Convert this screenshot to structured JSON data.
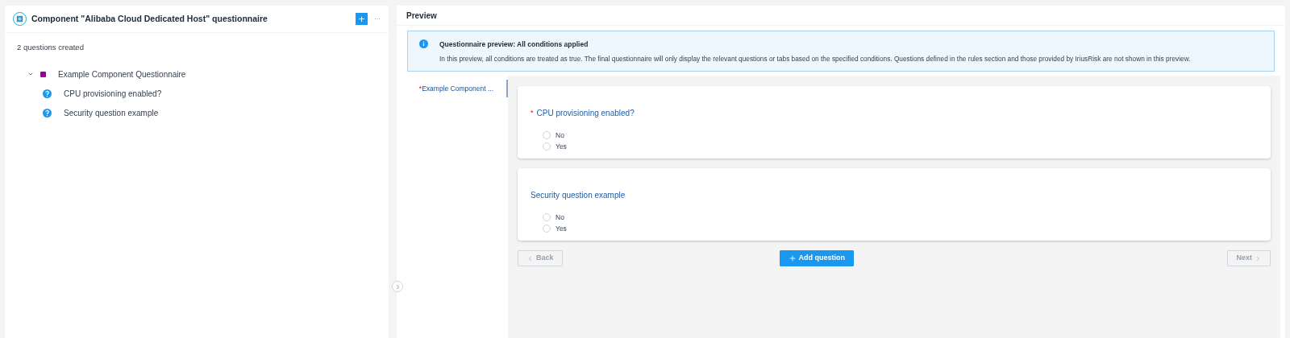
{
  "left_panel": {
    "title": "Component \"Alibaba Cloud Dedicated Host\" questionnaire",
    "add_button": "+",
    "more_button": "···",
    "count": "2 questions created",
    "tree": [
      {
        "label": "Example Component Questionnaire",
        "kind": "group",
        "color": "#8b0a8b",
        "expanded": true,
        "children": [
          {
            "label": "CPU provisioning enabled?",
            "kind": "question"
          },
          {
            "label": "Security question example",
            "kind": "question"
          }
        ]
      }
    ]
  },
  "preview": {
    "title": "Preview",
    "notice": {
      "title": "Questionnaire preview: All conditions applied",
      "text": "In this preview, all conditions are treated as true. The final questionnaire will only display the relevant questions or tabs based on the specified conditions. Questions defined in the rules section and those provided by IriusRisk are not shown in this preview."
    },
    "tabs": [
      {
        "required_mark": "*",
        "label": "Example Component ...",
        "selected": true
      }
    ],
    "questions": [
      {
        "required_mark": "*",
        "label": "CPU provisioning enabled?",
        "options": [
          {
            "label": "No",
            "selected": false
          },
          {
            "label": "Yes",
            "selected": false
          }
        ]
      },
      {
        "label": "Security question example",
        "options": [
          {
            "label": "No",
            "selected": false
          },
          {
            "label": "Yes",
            "selected": false
          }
        ]
      }
    ],
    "back_button": {
      "label": "Back",
      "disabled": true
    },
    "add_question_button": {
      "label": "Add question"
    },
    "next_button": {
      "label": "Next",
      "disabled": true
    }
  }
}
